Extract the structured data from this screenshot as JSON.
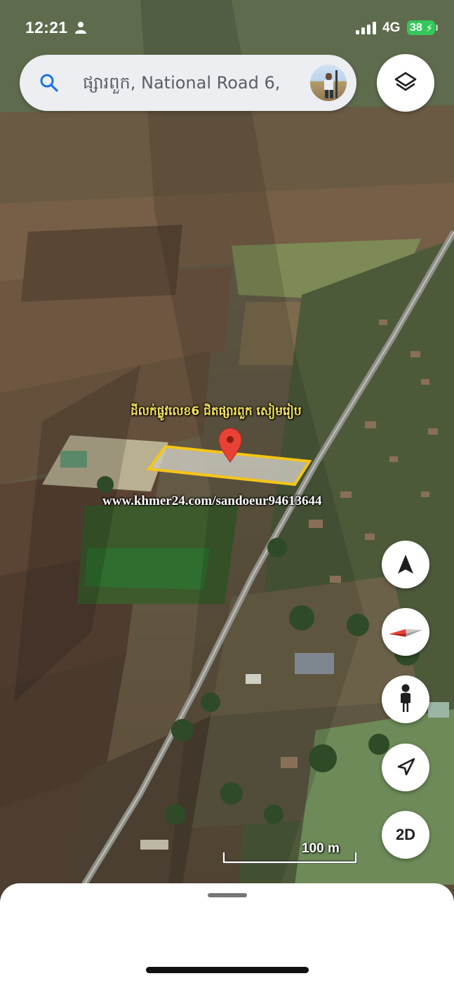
{
  "status_bar": {
    "time": "12:21",
    "network": "4G",
    "battery": "38",
    "signal_bars": 4
  },
  "search": {
    "text": "ផ្សារពួក, National Road 6,",
    "avatar_label": "profile-avatar"
  },
  "map": {
    "place_label": "ដីលក់ផ្លូវលេខ6 ជិតផ្សារពួក សៀមរៀប",
    "watermark": "www.khmer24.com/sandoeur94613644",
    "marker_color": "#e94235",
    "parcel_outline_color": "#f5c518"
  },
  "controls": {
    "layers_icon": "layers-icon",
    "compass_icon": "navigation-arrow-icon",
    "north_icon": "compass-needle-icon",
    "street_view_icon": "pegman-icon",
    "my_location_icon": "location-arrow-icon",
    "mode_toggle": "2D"
  },
  "scale": {
    "label": "100 m"
  },
  "colors": {
    "battery_green": "#34c759",
    "search_bg": "#eceef2",
    "icon_blue": "#1a73e8"
  }
}
